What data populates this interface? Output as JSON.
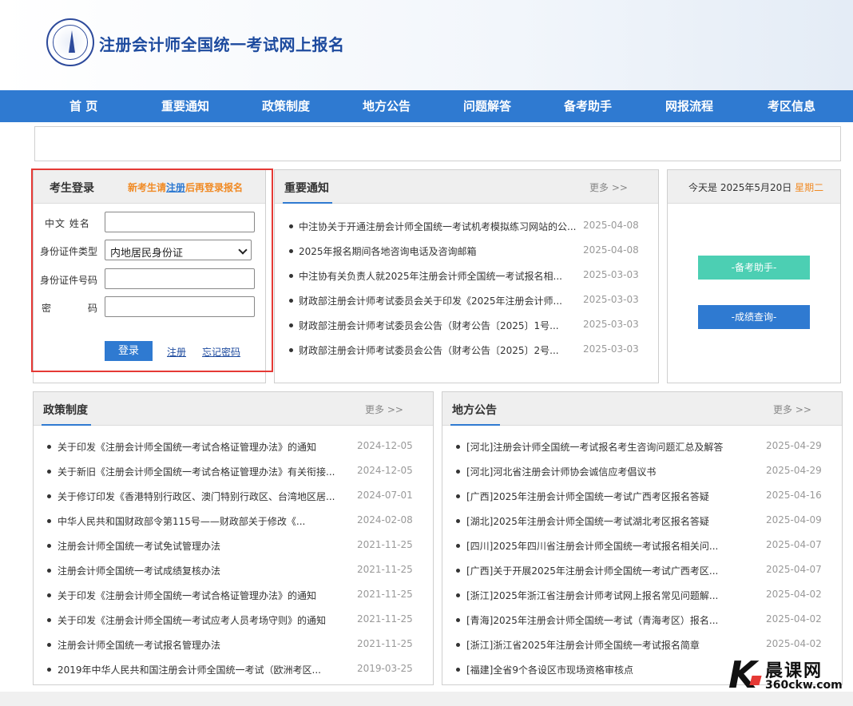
{
  "header": {
    "site_title": "注册会计师全国统一考试网上报名"
  },
  "nav": [
    {
      "label": "首 页"
    },
    {
      "label": "重要通知"
    },
    {
      "label": "政策制度"
    },
    {
      "label": "地方公告"
    },
    {
      "label": "问题解答"
    },
    {
      "label": "备考助手"
    },
    {
      "label": "网报流程"
    },
    {
      "label": "考区信息"
    }
  ],
  "login": {
    "title": "考生登录",
    "hint_prefix": "新考生请",
    "hint_link": "注册",
    "hint_suffix": "后再登录报名",
    "name_label": "中文 姓名",
    "id_type_label": "身份证件类型",
    "id_type_value": "内地居民身份证",
    "id_number_label": "身份证件号码",
    "password_label_1": "密",
    "password_label_2": "码",
    "name_value": "",
    "id_number_value": "",
    "password_value": "",
    "login_button": "登录",
    "register_link": "注册",
    "forgot_link": "忘记密码"
  },
  "notices": {
    "title": "重要通知",
    "more": "更多 >>",
    "items": [
      {
        "title": "中注协关于开通注册会计师全国统一考试机考模拟练习网站的公...",
        "date": "2025-04-08"
      },
      {
        "title": "2025年报名期间各地咨询电话及咨询邮箱",
        "date": "2025-04-08"
      },
      {
        "title": "中注协有关负责人就2025年注册会计师全国统一考试报名相...",
        "date": "2025-03-03"
      },
      {
        "title": "财政部注册会计师考试委员会关于印发《2025年注册会计师...",
        "date": "2025-03-03"
      },
      {
        "title": "财政部注册会计师考试委员会公告（财考公告〔2025〕1号...",
        "date": "2025-03-03"
      },
      {
        "title": "财政部注册会计师考试委员会公告（财考公告〔2025〕2号...",
        "date": "2025-03-03"
      }
    ]
  },
  "today": {
    "prefix": "今天是 2025年5月20日",
    "weekday": "星期二",
    "prep_button": "-备考助手-",
    "score_button": "-成绩查询-",
    "prep_color": "#4ccfb3",
    "score_color": "#2f7ad1"
  },
  "policy": {
    "title": "政策制度",
    "more": "更多 >>",
    "items": [
      {
        "title": "关于印发《注册会计师全国统一考试合格证管理办法》的通知",
        "date": "2024-12-05"
      },
      {
        "title": "关于新旧《注册会计师全国统一考试合格证管理办法》有关衔接...",
        "date": "2024-12-05"
      },
      {
        "title": "关于修订印发《香港特别行政区、澳门特别行政区、台湾地区居...",
        "date": "2024-07-01"
      },
      {
        "title": "中华人民共和国财政部令第115号——财政部关于修改《...",
        "date": "2024-02-08"
      },
      {
        "title": "注册会计师全国统一考试免试管理办法",
        "date": "2021-11-25"
      },
      {
        "title": "注册会计师全国统一考试成绩复核办法",
        "date": "2021-11-25"
      },
      {
        "title": "关于印发《注册会计师全国统一考试合格证管理办法》的通知",
        "date": "2021-11-25"
      },
      {
        "title": "关于印发《注册会计师全国统一考试应考人员考场守则》的通知",
        "date": "2021-11-25"
      },
      {
        "title": "注册会计师全国统一考试报名管理办法",
        "date": "2021-11-25"
      },
      {
        "title": "2019年中华人民共和国注册会计师全国统一考试（欧洲考区...",
        "date": "2019-03-25"
      }
    ]
  },
  "local": {
    "title": "地方公告",
    "more": "更多 >>",
    "items": [
      {
        "title": "[河北]注册会计师全国统一考试报名考生咨询问题汇总及解答",
        "date": "2025-04-29"
      },
      {
        "title": "[河北]河北省注册会计师协会诚信应考倡议书",
        "date": "2025-04-29"
      },
      {
        "title": "[广西]2025年注册会计师全国统一考试广西考区报名答疑",
        "date": "2025-04-16"
      },
      {
        "title": "[湖北]2025年注册会计师全国统一考试湖北考区报名答疑",
        "date": "2025-04-09"
      },
      {
        "title": "[四川]2025年四川省注册会计师全国统一考试报名相关问...",
        "date": "2025-04-07"
      },
      {
        "title": "[广西]关于开展2025年注册会计师全国统一考试广西考区...",
        "date": "2025-04-07"
      },
      {
        "title": "[浙江]2025年浙江省注册会计师考试网上报名常见问题解...",
        "date": "2025-04-02"
      },
      {
        "title": "[青海]2025年注册会计师全国统一考试（青海考区）报名...",
        "date": "2025-04-02"
      },
      {
        "title": "[浙江]浙江省2025年注册会计师全国统一考试报名简章",
        "date": "2025-04-02"
      },
      {
        "title": "[福建]全省9个各设区市现场资格审核点",
        "date": ""
      }
    ]
  },
  "watermark": {
    "letter": "K",
    "name": "晨课网",
    "url": "360ckw.com"
  },
  "colors": {
    "nav_blue": "#2f7ad1",
    "title_blue": "#1d4a9e",
    "hint_orange": "#f08a24",
    "highlight_frame": "#e53935"
  }
}
